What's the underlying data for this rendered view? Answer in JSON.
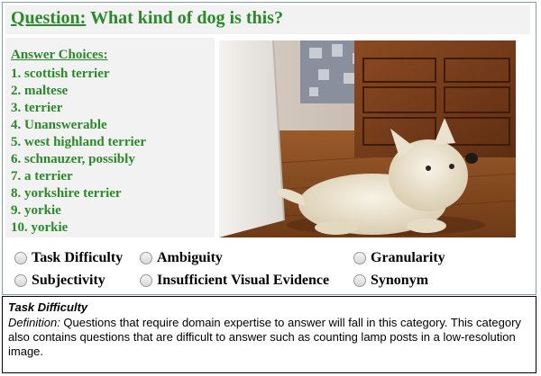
{
  "question": {
    "label": "Question:",
    "text": "What kind of dog is this?"
  },
  "answers": {
    "title": "Answer Choices:",
    "items": [
      "1. scottish terrier",
      "2. maltese",
      "3. terrier",
      "4. Unanswerable",
      "5. west highland terrier",
      "6. schnauzer, possibly",
      "7. a terrier",
      "8. yorkshire terrier",
      "9. yorkie",
      "10. yorkie"
    ]
  },
  "categories": {
    "task_difficulty": "Task Difficulty",
    "ambiguity": "Ambiguity",
    "granularity": "Granularity",
    "subjectivity": "Subjectivity",
    "insufficient_visual_evidence": "Insufficient Visual Evidence",
    "synonym": "Synonym"
  },
  "definition": {
    "heading": "Task Difficulty",
    "label": "Definition:",
    "text": " Questions that require domain expertise to answer will fall in this category.  This category also contains questions that are difficult to answer such as counting lamp posts in a low-resolution image."
  },
  "colors": {
    "answer_green": "#2a8a2a",
    "panel_gray": "#f2f2f2",
    "frame_border": "#7ba5a7"
  }
}
